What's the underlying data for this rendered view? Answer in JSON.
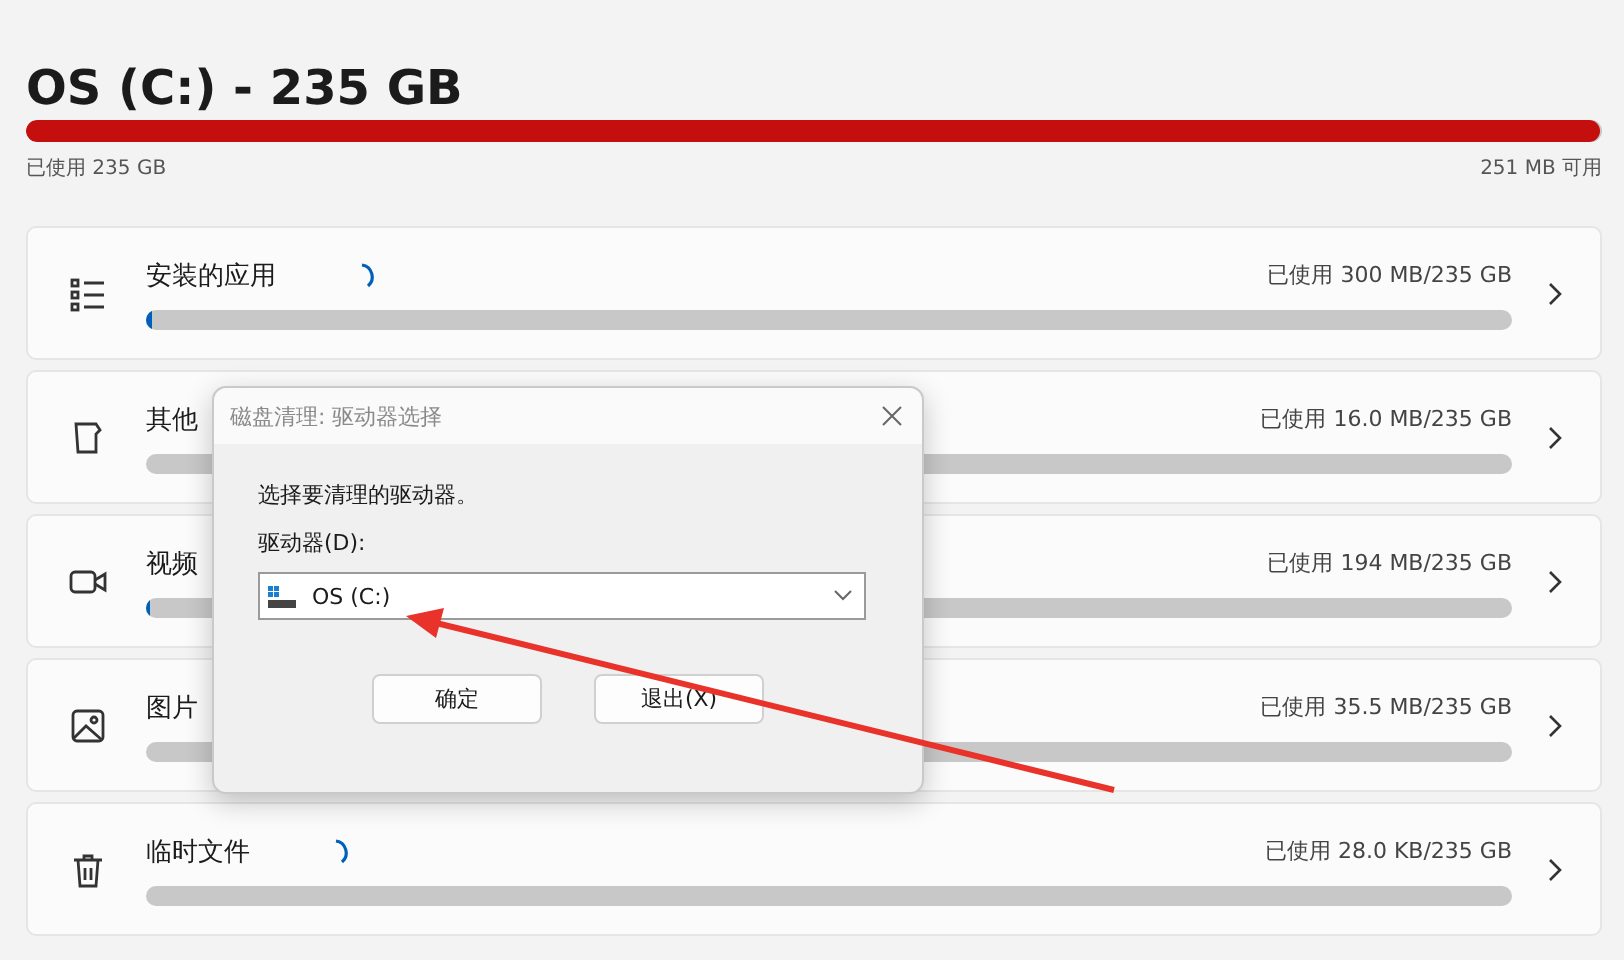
{
  "drive": {
    "title": "OS (C:) - 235 GB",
    "level": 0.999,
    "used": "已使用 235 GB",
    "free": "251 MB 可用"
  },
  "categories": [
    {
      "kind": "apps",
      "label": "安装的应用",
      "loading": true,
      "reading": "已使用 300 MB/235 GB",
      "level": 0.004
    },
    {
      "kind": "other",
      "label": "其他",
      "loading": false,
      "reading": "已使用 16.0 MB/235 GB"
    },
    {
      "kind": "video",
      "label": "视频",
      "loading": false,
      "reading": "已使用 194 MB/235 GB",
      "level": 0.003
    },
    {
      "kind": "pictures",
      "label": "图片",
      "loading": false,
      "reading": "已使用 35.5 MB/235 GB"
    },
    {
      "kind": "temp",
      "label": "临时文件",
      "loading": true,
      "reading": "已使用 28.0 KB/235 GB"
    }
  ],
  "dialog": {
    "title": "磁盘清理: 驱动器选择",
    "prompt": "选择要清理的驱动器。",
    "field_label": "驱动器(D):",
    "drive_value": "OS (C:)",
    "buttons": [
      "确定",
      "退出(X)"
    ]
  }
}
